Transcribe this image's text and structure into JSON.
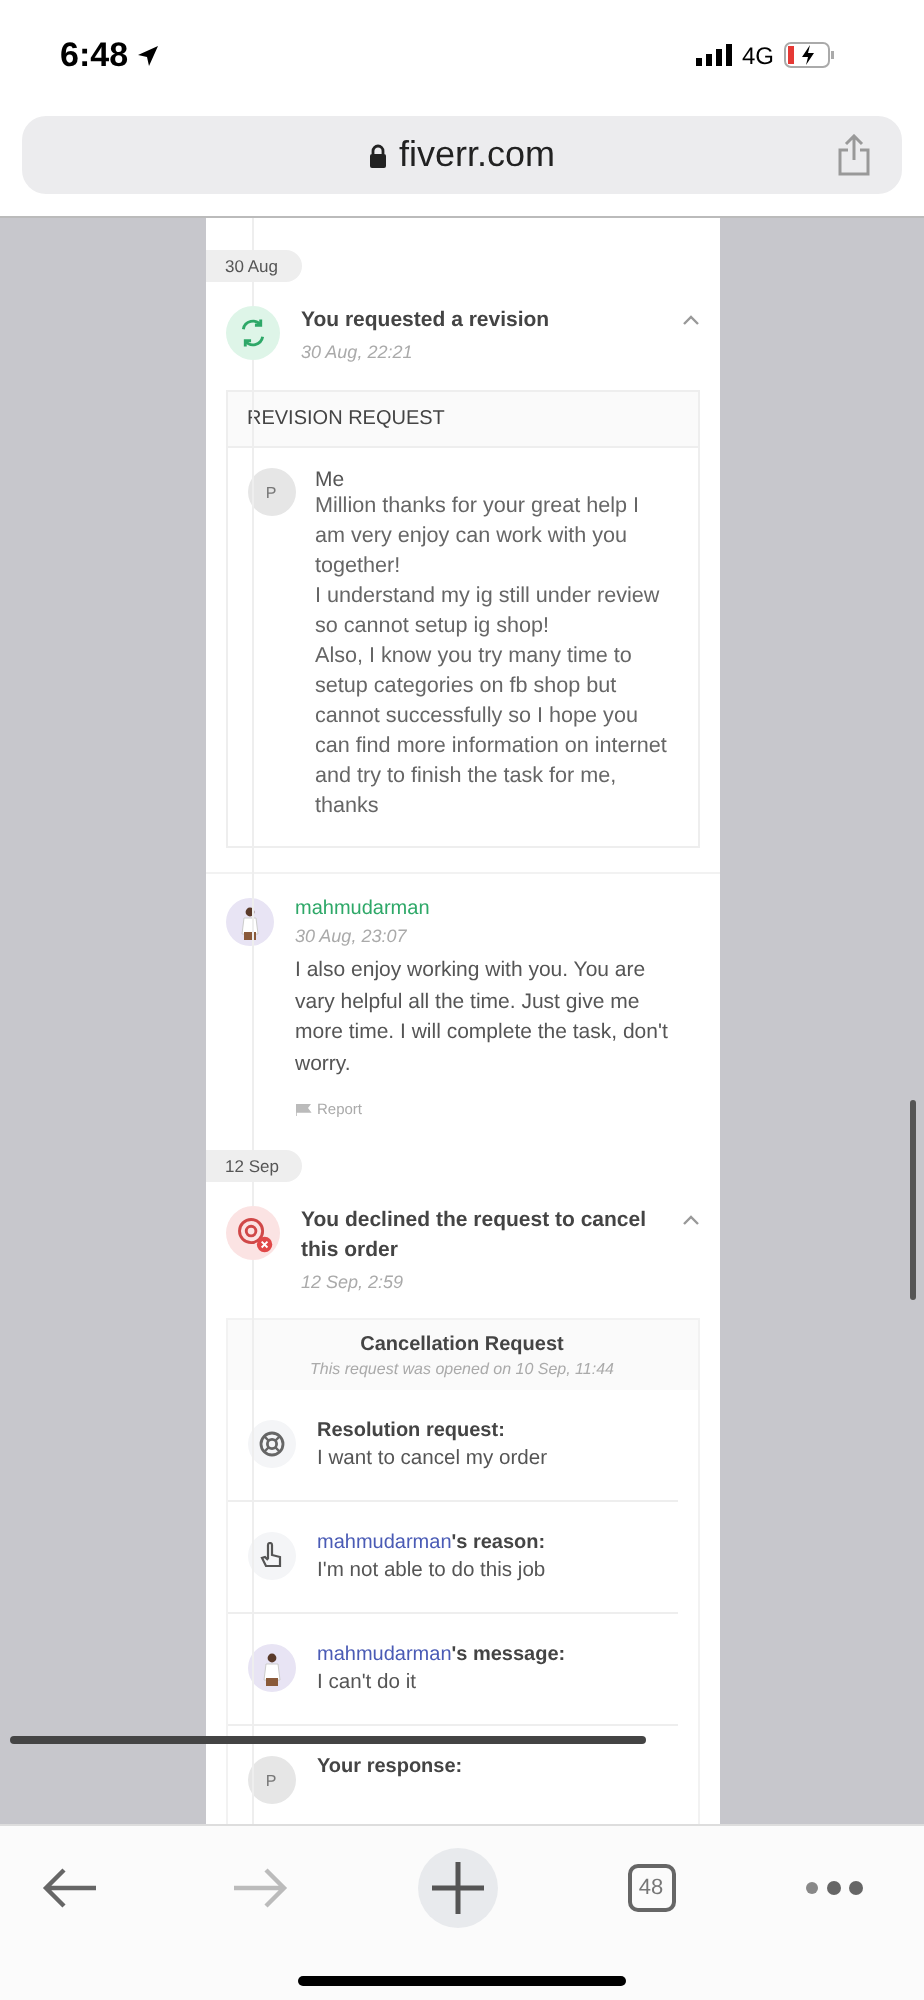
{
  "status_bar": {
    "time": "6:48",
    "network": "4G"
  },
  "address_bar": {
    "url": "fiverr.com"
  },
  "timeline": [
    {
      "kind": "date",
      "label": "30 Aug"
    },
    {
      "kind": "revision_event",
      "title": "You requested a revision",
      "time": "30 Aug, 22:21",
      "expanded": true,
      "panel": {
        "kind": "revision",
        "heading": "REVISION REQUEST",
        "avatar": "P",
        "author": "Me",
        "text": "Million thanks for your great help I am very enjoy can work with you together!\nI understand my ig still under review so cannot setup ig shop!\nAlso, I know you try many time to setup categories on fb shop but cannot successfully so I hope you can find more information on internet and try to finish the task for me, thanks"
      }
    },
    {
      "kind": "message",
      "author": "mahmudarman",
      "time": "30 Aug, 23:07",
      "text": "I also enjoy working with you. You are vary helpful all the time. Just give me more time. I will complete the task, don't worry.",
      "action": "Report"
    },
    {
      "kind": "date",
      "label": "12 Sep"
    },
    {
      "kind": "declined_event",
      "title": "You declined the request to cancel this order",
      "time": "12 Sep, 2:59",
      "expanded": true,
      "panel": {
        "kind": "cancellation",
        "heading": "Cancellation Request",
        "subheading": "This request was opened on 10 Sep, 11:44",
        "items": [
          {
            "kind": "lifebuoy",
            "label": "Resolution request:",
            "text": "I want to cancel my order"
          },
          {
            "kind": "hand",
            "user": "mahmudarman",
            "label": "'s reason:",
            "text": "I'm not able to do this job"
          },
          {
            "kind": "photo",
            "user": "mahmudarman",
            "label": "'s message:",
            "text": "I can't do it"
          },
          {
            "kind": "initial",
            "avatar": "P",
            "label": "Your response:"
          }
        ]
      }
    }
  ],
  "toolbar": {
    "tabs_count": "48"
  }
}
